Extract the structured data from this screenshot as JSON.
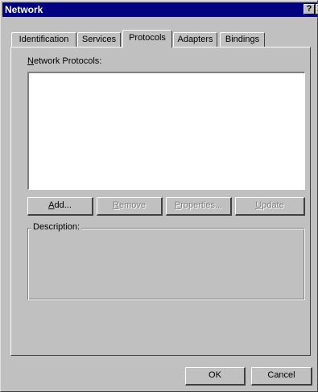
{
  "window": {
    "title": "Network",
    "help_glyph": "?",
    "close_glyph": "X"
  },
  "tabs": [
    {
      "label": "Identification",
      "active": false
    },
    {
      "label": "Services",
      "active": false
    },
    {
      "label": "Protocols",
      "active": true
    },
    {
      "label": "Adapters",
      "active": false
    },
    {
      "label": "Bindings",
      "active": false
    }
  ],
  "protocols_tab": {
    "list_label_prefix": "",
    "list_label_accel": "N",
    "list_label_rest": "etwork Protocols:",
    "items": [],
    "buttons": {
      "add": {
        "accel": "A",
        "rest": "dd...",
        "enabled": true
      },
      "remove": {
        "accel": "R",
        "rest": "emove",
        "enabled": false
      },
      "properties": {
        "accel": "P",
        "rest": "roperties...",
        "enabled": false
      },
      "update": {
        "accel": "U",
        "rest": "pdate",
        "enabled": false
      }
    },
    "description_label": "Description:",
    "description_text": ""
  },
  "dialog_buttons": {
    "ok": "OK",
    "cancel": "Cancel"
  }
}
